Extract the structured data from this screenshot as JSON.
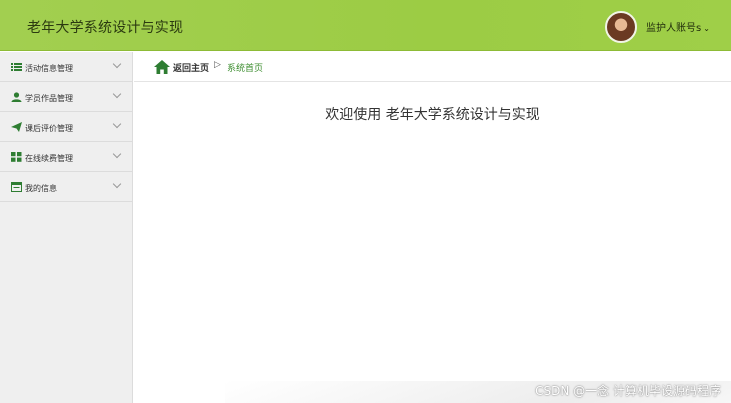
{
  "header": {
    "title": "老年大学系统设计与实现",
    "user_label": "监护人账号s",
    "user_caret": "⌄"
  },
  "sidebar": {
    "items": [
      {
        "label": "活动信息管理",
        "icon": "list-icon"
      },
      {
        "label": "学员作品管理",
        "icon": "user-icon"
      },
      {
        "label": "课后评价管理",
        "icon": "paper-plane-icon"
      },
      {
        "label": "在线续费管理",
        "icon": "grid-icon"
      },
      {
        "label": "我的信息",
        "icon": "window-icon"
      }
    ]
  },
  "breadcrumb": {
    "home_label": "返回主页",
    "separator": "▷",
    "current": "系统首页"
  },
  "main": {
    "welcome": "欢迎使用 老年大学系统设计与实现"
  },
  "watermark": "CSDN @一念 计算机毕设源码程序",
  "colors": {
    "header_green": "#9ccc44",
    "icon_green": "#2e7d32",
    "current_green": "#3c8d2f"
  }
}
